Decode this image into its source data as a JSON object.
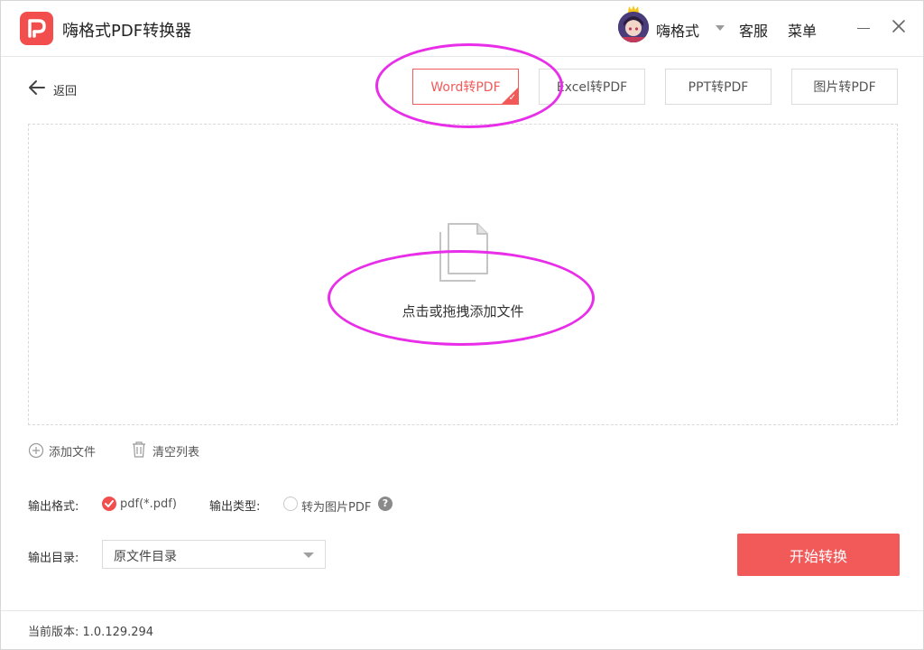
{
  "app": {
    "title": "嗨格式PDF转换器",
    "accent": "#f24e4e"
  },
  "header": {
    "user_name": "嗨格式",
    "service_label": "客服",
    "menu_label": "菜单"
  },
  "nav": {
    "back_label": "返回"
  },
  "tabs": [
    {
      "label": "Word转PDF",
      "active": true
    },
    {
      "label": "Excel转PDF",
      "active": false
    },
    {
      "label": "PPT转PDF",
      "active": false
    },
    {
      "label": "图片转PDF",
      "active": false
    }
  ],
  "dropzone": {
    "text": "点击或拖拽添加文件"
  },
  "file_actions": {
    "add_label": "添加文件",
    "clear_label": "清空列表"
  },
  "output": {
    "format_label": "输出格式:",
    "format_value": "pdf(*.pdf)",
    "type_label": "输出类型:",
    "type_option": "转为图片PDF",
    "help_glyph": "?",
    "dir_label": "输出目录:",
    "dir_value": "原文件目录"
  },
  "actions": {
    "start_label": "开始转换"
  },
  "footer": {
    "version_text": "当前版本: 1.0.129.294"
  },
  "annotation_color": "#e82ee8"
}
